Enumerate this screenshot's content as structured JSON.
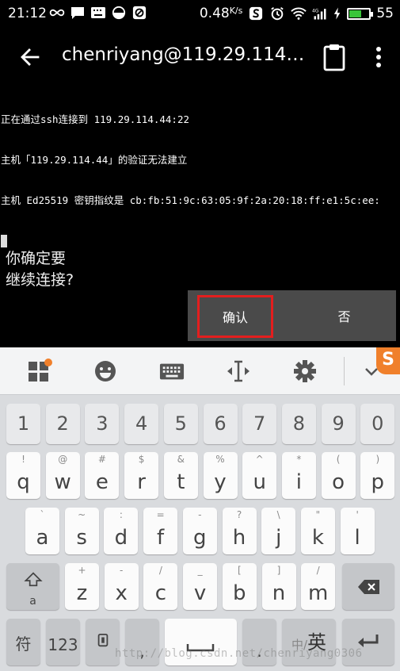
{
  "status": {
    "time": "21:12",
    "net_speed": "0.48",
    "net_unit": "K/s",
    "signal_label": "4G",
    "battery": "55",
    "battery_color": "#3ac53a"
  },
  "appbar": {
    "title": "chenriyang@119.29.114…"
  },
  "terminal": {
    "lines": [
      "正在通过ssh连接到 119.29.114.44:22",
      "主机「119.29.114.44」的验证无法建立",
      "主机 Ed25519 密钥指纹是 cb:fb:51:9c:63:05:9f:2a:20:18:ff:e1:5c:ee:"
    ],
    "prompt_line1": "你确定要",
    "prompt_line2": "继续连接?",
    "confirm_label": "确认",
    "deny_label": "否",
    "highlight_color": "#e41e1e"
  },
  "keyboard": {
    "numbers": [
      "1",
      "2",
      "3",
      "4",
      "5",
      "6",
      "7",
      "8",
      "9",
      "0"
    ],
    "row1": [
      {
        "main": "q",
        "sub": "!"
      },
      {
        "main": "w",
        "sub": "@"
      },
      {
        "main": "e",
        "sub": "#"
      },
      {
        "main": "r",
        "sub": "$"
      },
      {
        "main": "t",
        "sub": "&"
      },
      {
        "main": "y",
        "sub": "%"
      },
      {
        "main": "u",
        "sub": "^"
      },
      {
        "main": "i",
        "sub": "*"
      },
      {
        "main": "o",
        "sub": "("
      },
      {
        "main": "p",
        "sub": ")"
      }
    ],
    "row2": [
      {
        "main": "a",
        "sub": "`"
      },
      {
        "main": "s",
        "sub": "~"
      },
      {
        "main": "d",
        "sub": ":"
      },
      {
        "main": "f",
        "sub": "="
      },
      {
        "main": "g",
        "sub": "-"
      },
      {
        "main": "h",
        "sub": "?"
      },
      {
        "main": "j",
        "sub": "\\"
      },
      {
        "main": "k",
        "sub": "\""
      },
      {
        "main": "l",
        "sub": "'"
      }
    ],
    "row3": [
      {
        "main": "z",
        "sub": "+"
      },
      {
        "main": "x",
        "sub": "-"
      },
      {
        "main": "c",
        "sub": "/"
      },
      {
        "main": "v",
        "sub": "_"
      },
      {
        "main": "b",
        "sub": "["
      },
      {
        "main": "n",
        "sub": "]"
      },
      {
        "main": "m",
        "sub": "/"
      }
    ],
    "shift_sub": "a",
    "symbol_label": "符",
    "num_label": "123",
    "comma_label": ",",
    "period_label": ".",
    "lang_label_zh": "中",
    "lang_label_en": "英",
    "lang_sep": "/",
    "logo": "S",
    "accent": "#f0802b"
  },
  "watermark": "http://blog.csdn.net/chenriyang0306"
}
